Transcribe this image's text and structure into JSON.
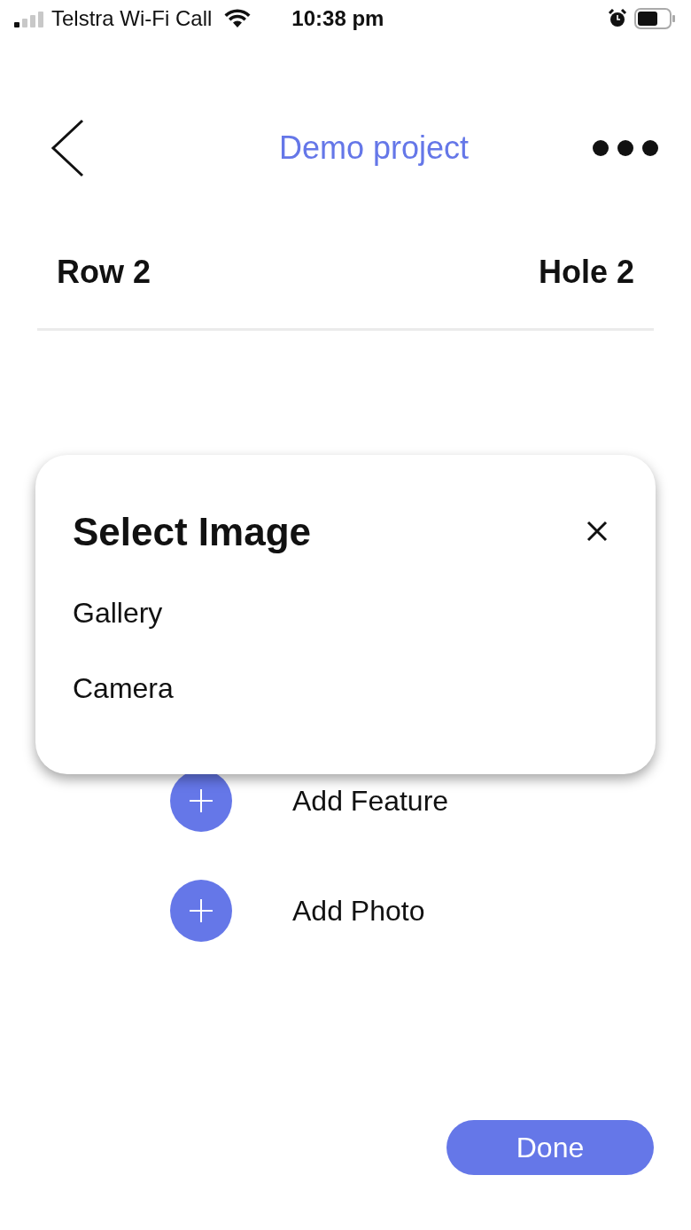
{
  "status_bar": {
    "carrier": "Telstra Wi-Fi Call",
    "time": "10:38 pm"
  },
  "header": {
    "title": "Demo project"
  },
  "location": {
    "row": "Row 2",
    "hole": "Hole 2"
  },
  "actions": [
    {
      "label": "Add Feature"
    },
    {
      "label": "Add Photo"
    }
  ],
  "dialog": {
    "title": "Select Image",
    "options": [
      {
        "label": "Gallery"
      },
      {
        "label": "Camera"
      }
    ]
  },
  "done_button": "Done"
}
